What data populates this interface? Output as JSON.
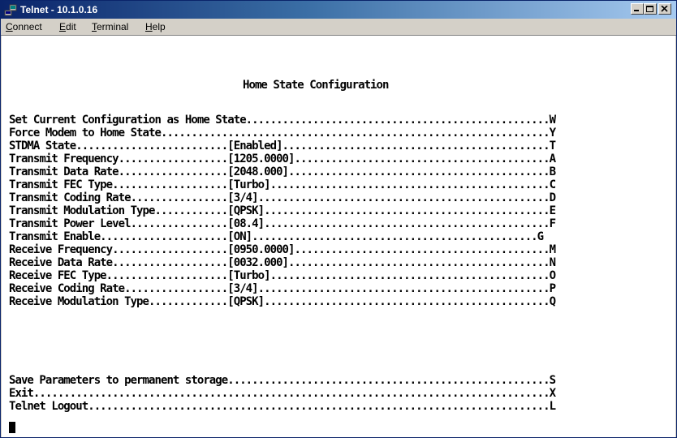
{
  "window": {
    "title": "Telnet - 10.1.0.16"
  },
  "menu": {
    "connect": {
      "first": "C",
      "rest": "onnect"
    },
    "edit": {
      "first": "E",
      "rest": "dit"
    },
    "terminal": {
      "first": "T",
      "rest": "erminal"
    },
    "help": {
      "first": "H",
      "rest": "elp"
    }
  },
  "screen": {
    "heading": "Home State Configuration",
    "lines": [
      "Set Current Configuration as Home State..................................................W",
      "Force Modem to Home State................................................................Y",
      "STDMA State.........................[Enabled]............................................T",
      "Transmit Frequency..................[1205.0000]..........................................A",
      "Transmit Data Rate..................[2048.000]...........................................B",
      "Transmit FEC Type...................[Turbo]..............................................C",
      "Transmit Coding Rate................[3/4]................................................D",
      "Transmit Modulation Type............[QPSK]...............................................E",
      "Transmit Power Level................[08.4]...............................................F",
      "Transmit Enable.....................[ON]...............................................G",
      "Receive Frequency...................[0950.0000]..........................................M",
      "Receive Data Rate...................[0032.000]...........................................N",
      "Receive FEC Type....................[Turbo]..............................................O",
      "Receive Coding Rate.................[3/4]................................................P",
      "Receive Modulation Type.............[QPSK]...............................................Q"
    ],
    "footer_lines": [
      "Save Parameters to permanent storage.....................................................S",
      "Exit.....................................................................................X",
      "Telnet Logout............................................................................L"
    ]
  },
  "colors": {
    "titlebar_start": "#0a246a",
    "titlebar_end": "#a6caf0",
    "chrome": "#d4d0c8",
    "terminal_bg": "#ffffff",
    "terminal_fg": "#000000"
  },
  "icons": {
    "app": "telnet-computer-icon",
    "minimize": "minimize-icon",
    "maximize": "maximize-icon",
    "close": "close-icon"
  }
}
